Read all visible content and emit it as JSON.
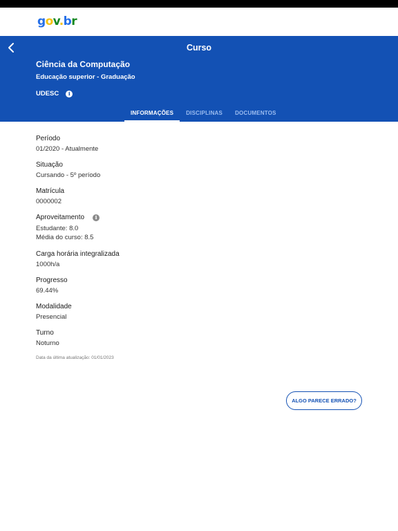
{
  "logo": {
    "g": "g",
    "o": "o",
    "v": "v",
    "dot": ".",
    "b": "b",
    "r": "r"
  },
  "header": {
    "title": "Curso",
    "course_name": "Ciência da Computação",
    "course_level": "Educação superior - Graduação",
    "institution": "UDESC",
    "info_glyph": "i"
  },
  "tabs": [
    {
      "label": "INFORMAÇÕES",
      "active": true
    },
    {
      "label": "DISCIPLINAS",
      "active": false
    },
    {
      "label": "DOCUMENTOS",
      "active": false
    }
  ],
  "fields": {
    "periodo": {
      "label": "Período",
      "value": "01/2020 - Atualmente"
    },
    "situacao": {
      "label": "Situação",
      "value": "Cursando - 5º período"
    },
    "matricula": {
      "label": "Matrícula",
      "value": "0000002"
    },
    "aproveitamento": {
      "label": "Aproveitamento",
      "info_glyph": "i",
      "estudante_label": "Estudante:",
      "estudante_value": "8.0",
      "media_label": "Média do curso:",
      "media_value": "8.5"
    },
    "carga": {
      "label": "Carga horária integralizada",
      "value": "1000h/a"
    },
    "progresso": {
      "label": "Progresso",
      "value": "69.44%"
    },
    "modalidade": {
      "label": "Modalidade",
      "value": "Presencial"
    },
    "turno": {
      "label": "Turno",
      "value": "Noturno"
    }
  },
  "last_updated": "Data da última atualização: 01/01/2023",
  "wrong_button": "ALGO PARECE ERRADO?",
  "colors": {
    "primary": "#1351b4",
    "tab_inactive": "#9bbcf0",
    "text": "#1b1b1b"
  }
}
